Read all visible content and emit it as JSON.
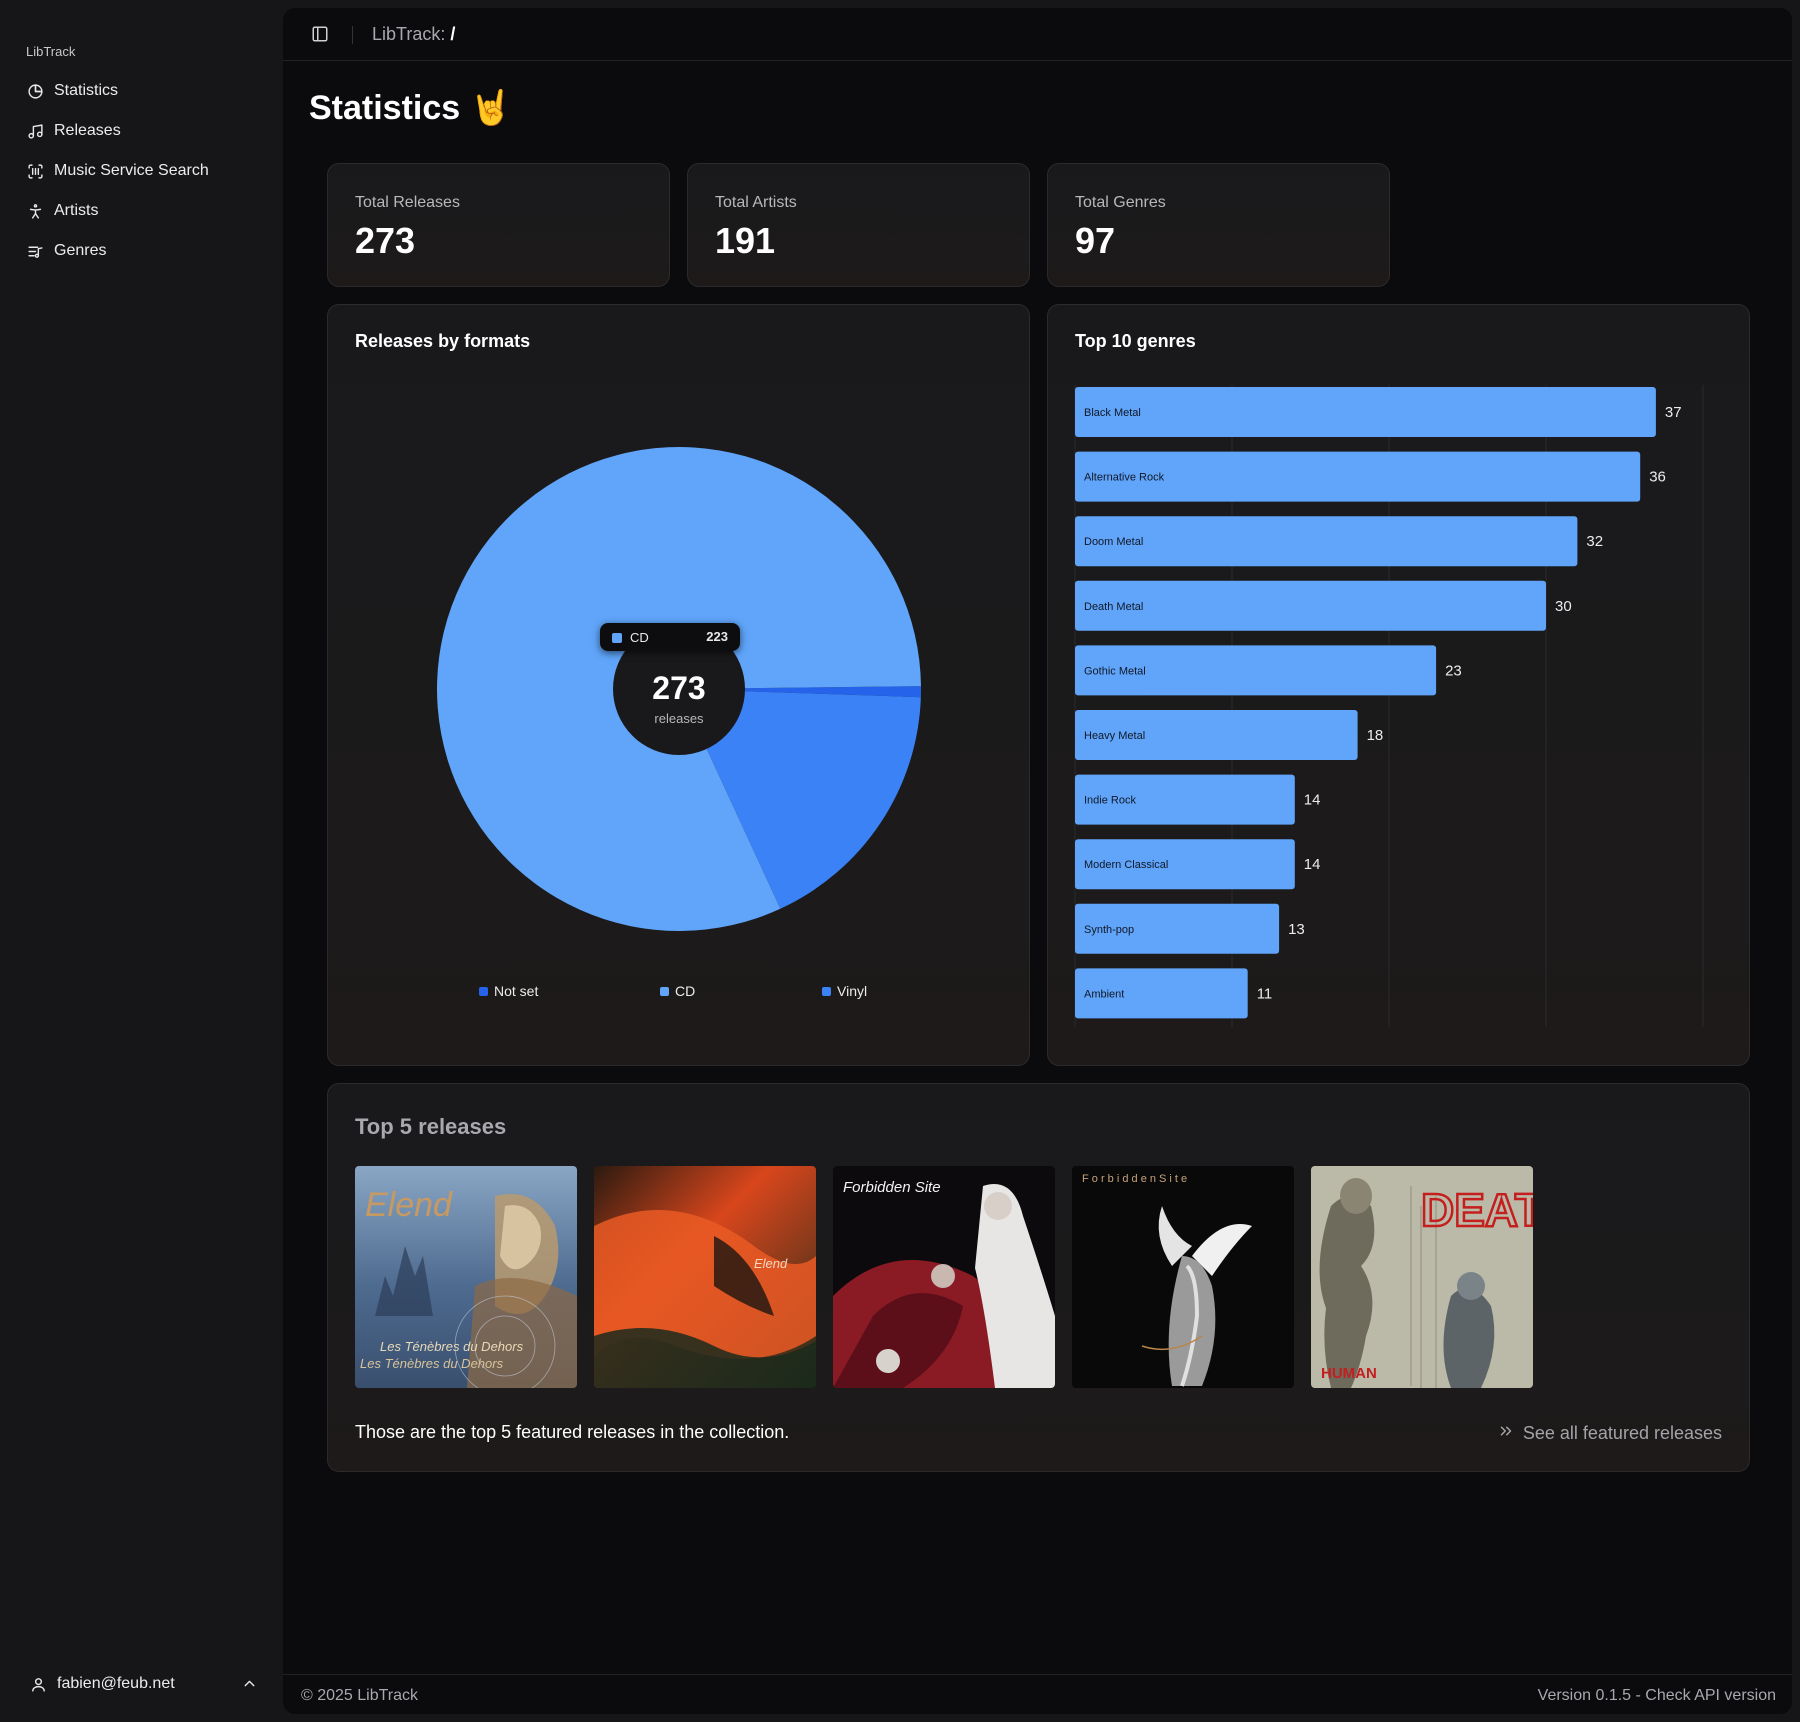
{
  "sidebar": {
    "brand": "LibTrack",
    "items": [
      {
        "label": "Statistics",
        "icon": "pie-chart-icon"
      },
      {
        "label": "Releases",
        "icon": "music-note-icon"
      },
      {
        "label": "Music Service Search",
        "icon": "scan-icon"
      },
      {
        "label": "Artists",
        "icon": "person-icon"
      },
      {
        "label": "Genres",
        "icon": "list-music-icon"
      }
    ],
    "user": "fabien@feub.net"
  },
  "topbar": {
    "crumb_prefix": "LibTrack:",
    "crumb_path": "/"
  },
  "page": {
    "title": "Statistics 🤘"
  },
  "stats": [
    {
      "label": "Total Releases",
      "value": "273"
    },
    {
      "label": "Total Artists",
      "value": "191"
    },
    {
      "label": "Total Genres",
      "value": "97"
    }
  ],
  "formats_card": {
    "title": "Releases by formats",
    "center_value": "273",
    "center_label": "releases",
    "tooltip": {
      "label": "CD",
      "value": "223"
    },
    "colors": {
      "Not set": "#2563eb",
      "CD": "#60a5fa",
      "Vinyl": "#3b82f6"
    }
  },
  "genres_card": {
    "title": "Top 10 genres",
    "bar_color": "#60a5fa"
  },
  "chart_data": [
    {
      "type": "pie",
      "title": "Releases by formats",
      "categories": [
        "Not set",
        "CD",
        "Vinyl"
      ],
      "values": [
        2,
        223,
        48
      ],
      "legend": "bottom"
    },
    {
      "type": "bar",
      "orientation": "horizontal",
      "title": "Top 10 genres",
      "categories": [
        "Black Metal",
        "Alternative Rock",
        "Doom Metal",
        "Death Metal",
        "Gothic Metal",
        "Heavy Metal",
        "Indie Rock",
        "Modern Classical",
        "Synth-pop",
        "Ambient"
      ],
      "values": [
        37,
        36,
        32,
        30,
        23,
        18,
        14,
        14,
        13,
        11
      ],
      "xlim": [
        0,
        40
      ],
      "grid": true
    }
  ],
  "top_releases": {
    "title": "Top 5 releases",
    "covers": [
      {
        "name": "cover-elend-tenebres",
        "title_art": "Elend",
        "subtitle_art": "Les Ténèbres du Dehors"
      },
      {
        "name": "cover-elend-red",
        "title_art": "Elend",
        "subtitle_art": ""
      },
      {
        "name": "cover-forbidden-site-1",
        "title_art": "Forbidden Site",
        "subtitle_art": ""
      },
      {
        "name": "cover-forbidden-site-astralgeist",
        "title_art": "F o r b i d d e n   S i t e",
        "subtitle_art": ""
      },
      {
        "name": "cover-death-human",
        "title_art": "DEATH",
        "subtitle_art": "HUMAN"
      }
    ],
    "note": "Those are the top 5 featured releases in the collection.",
    "see_all": "See all featured releases"
  },
  "footer": {
    "copyright": "© 2025 LibTrack",
    "version": "Version 0.1.5 - Check API version"
  }
}
